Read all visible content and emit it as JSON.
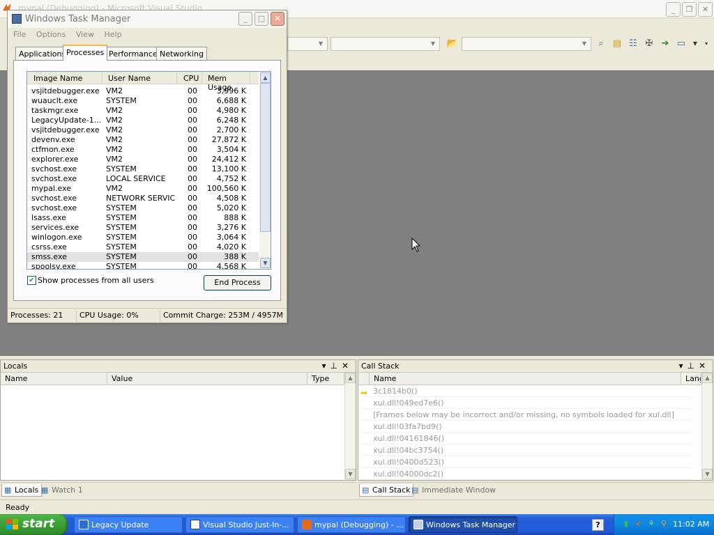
{
  "vs": {
    "title": "mypal (Debugging) - Microsoft Visual Studio",
    "status": "Ready"
  },
  "locals": {
    "title": "Locals",
    "columns": [
      "Name",
      "Value",
      "Type"
    ],
    "tabs": [
      "Locals",
      "Watch 1"
    ]
  },
  "callstack": {
    "title": "Call Stack",
    "columns": [
      "Name",
      "Langu"
    ],
    "rows": [
      "3c1814b0()",
      "xul.dll!049ed7e6()",
      "[Frames below may be incorrect and/or missing, no symbols loaded for xul.dll]",
      "xul.dll!03fa7bd9()",
      "xul.dll!04161846()",
      "xul.dll!04bc3754()",
      "xul.dll!0400d523()",
      "xul.dll!04000dc2()"
    ],
    "tabs": [
      "Call Stack",
      "Immediate Window"
    ]
  },
  "taskmgr": {
    "title": "Windows Task Manager",
    "menu": [
      "File",
      "Options",
      "View",
      "Help"
    ],
    "tabs": [
      "Applications",
      "Processes",
      "Performance",
      "Networking"
    ],
    "columns": [
      "Image Name",
      "User Name",
      "CPU",
      "Mem Usage"
    ],
    "processes": [
      {
        "name": "vsjitdebugger.exe",
        "user": "VM2",
        "cpu": "00",
        "mem": "3,996 K"
      },
      {
        "name": "wuauclt.exe",
        "user": "SYSTEM",
        "cpu": "00",
        "mem": "6,688 K"
      },
      {
        "name": "taskmgr.exe",
        "user": "VM2",
        "cpu": "00",
        "mem": "4,980 K"
      },
      {
        "name": "LegacyUpdate-1....",
        "user": "VM2",
        "cpu": "00",
        "mem": "6,248 K"
      },
      {
        "name": "vsjitdebugger.exe",
        "user": "VM2",
        "cpu": "00",
        "mem": "2,700 K"
      },
      {
        "name": "devenv.exe",
        "user": "VM2",
        "cpu": "00",
        "mem": "27,872 K"
      },
      {
        "name": "ctfmon.exe",
        "user": "VM2",
        "cpu": "00",
        "mem": "3,504 K"
      },
      {
        "name": "explorer.exe",
        "user": "VM2",
        "cpu": "00",
        "mem": "24,412 K"
      },
      {
        "name": "svchost.exe",
        "user": "SYSTEM",
        "cpu": "00",
        "mem": "13,100 K"
      },
      {
        "name": "svchost.exe",
        "user": "LOCAL SERVICE",
        "cpu": "00",
        "mem": "4,752 K"
      },
      {
        "name": "mypal.exe",
        "user": "VM2",
        "cpu": "00",
        "mem": "100,560 K"
      },
      {
        "name": "svchost.exe",
        "user": "NETWORK SERVICE",
        "cpu": "00",
        "mem": "4,508 K"
      },
      {
        "name": "svchost.exe",
        "user": "SYSTEM",
        "cpu": "00",
        "mem": "5,020 K"
      },
      {
        "name": "lsass.exe",
        "user": "SYSTEM",
        "cpu": "00",
        "mem": "888 K"
      },
      {
        "name": "services.exe",
        "user": "SYSTEM",
        "cpu": "00",
        "mem": "3,276 K"
      },
      {
        "name": "winlogon.exe",
        "user": "SYSTEM",
        "cpu": "00",
        "mem": "3,064 K"
      },
      {
        "name": "csrss.exe",
        "user": "SYSTEM",
        "cpu": "00",
        "mem": "4,020 K"
      },
      {
        "name": "smss.exe",
        "user": "SYSTEM",
        "cpu": "00",
        "mem": "388 K"
      },
      {
        "name": "spoolsv.exe",
        "user": "SYSTEM",
        "cpu": "00",
        "mem": "4,568 K"
      }
    ],
    "selected_index": 17,
    "show_all_label": "Show processes from all users",
    "show_all_checked": true,
    "end_process_label": "End Process",
    "status": {
      "processes": "Processes: 21",
      "cpu": "CPU Usage: 0%",
      "commit": "Commit Charge: 253M / 4957M"
    }
  },
  "taskbar": {
    "start_label": "start",
    "tasks": [
      {
        "label": "Legacy Update",
        "icon": "legacy-update-icon",
        "active": false
      },
      {
        "label": "Visual Studio Just-In-...",
        "icon": "vs-jit-icon",
        "active": false
      },
      {
        "label": "mypal (Debugging) - ...",
        "icon": "visual-studio-icon",
        "active": false
      },
      {
        "label": "Windows Task Manager",
        "icon": "task-manager-icon",
        "active": true
      }
    ],
    "clock": "11:02 AM"
  },
  "colors": {
    "editor_bg": "#808080",
    "taskbar_blue": "#245edb",
    "start_green": "#3b9f36",
    "selected_tab_accent": "#f9b84b"
  }
}
